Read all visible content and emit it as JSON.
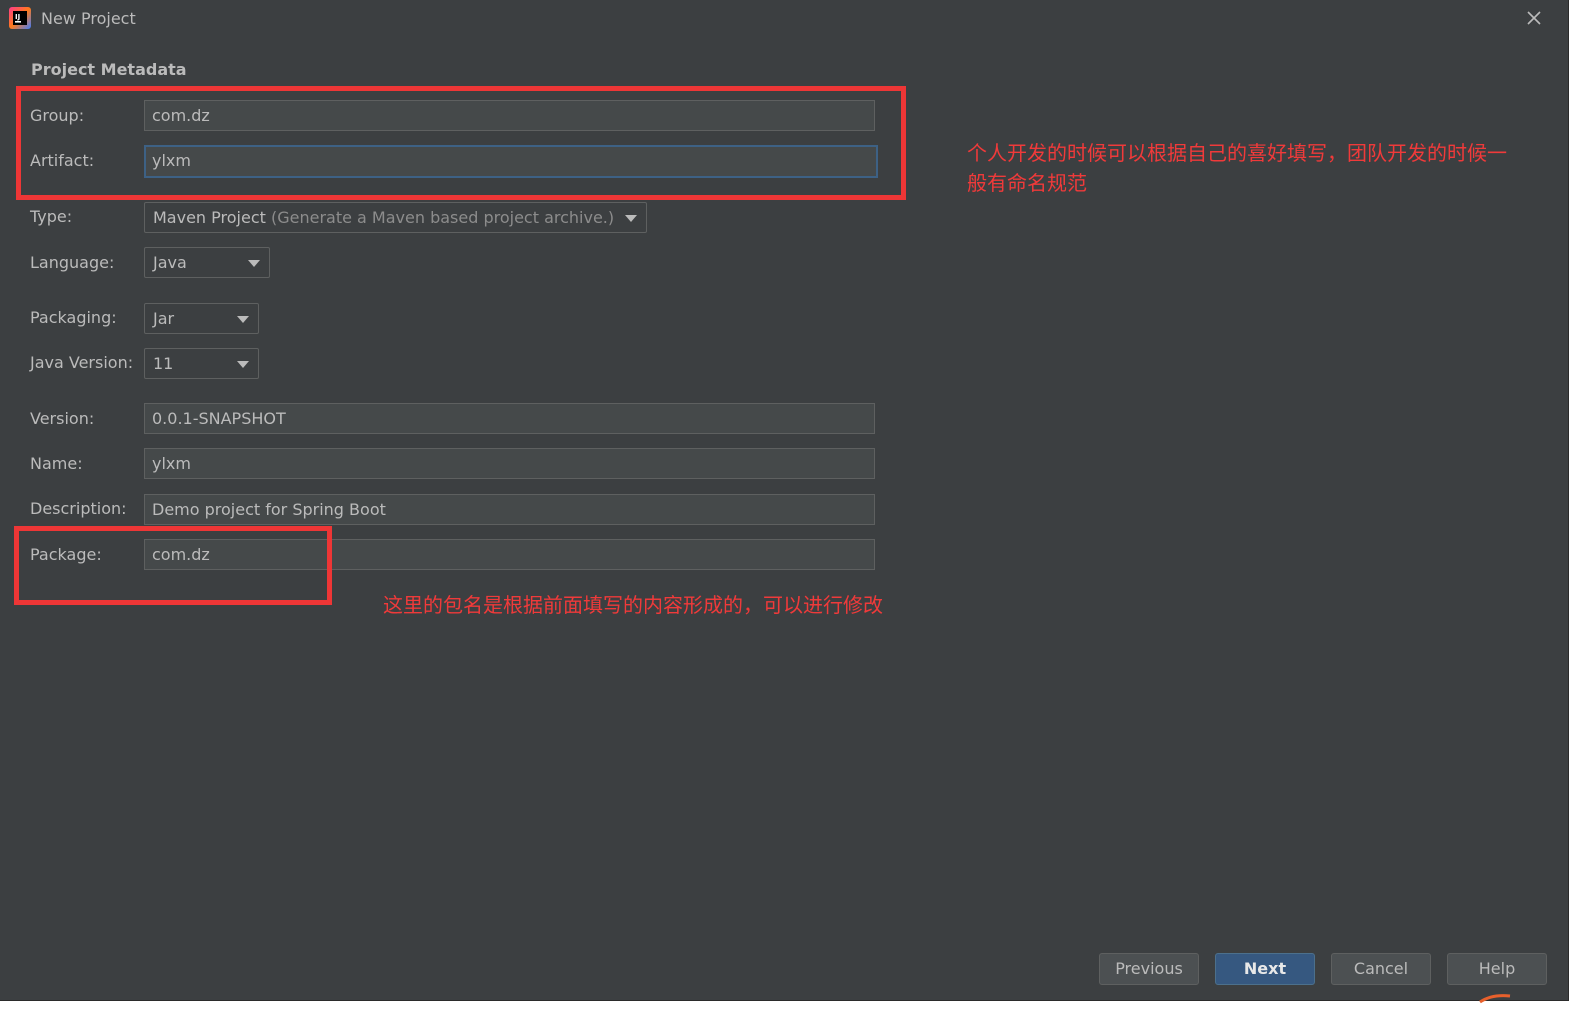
{
  "window": {
    "title": "New Project"
  },
  "section": {
    "title": "Project Metadata"
  },
  "form": {
    "group": {
      "label": "Group:",
      "value": "com.dz"
    },
    "artifact": {
      "label": "Artifact:",
      "value": "ylxm"
    },
    "type": {
      "label": "Type:",
      "value": "Maven Project",
      "hint": "(Generate a Maven based project archive.)"
    },
    "language": {
      "label": "Language:",
      "value": "Java"
    },
    "packaging": {
      "label": "Packaging:",
      "value": "Jar"
    },
    "java_version": {
      "label": "Java Version:",
      "value": "11"
    },
    "version": {
      "label": "Version:",
      "value": "0.0.1-SNAPSHOT"
    },
    "name": {
      "label": "Name:",
      "value": "ylxm"
    },
    "description": {
      "label": "Description:",
      "value": "Demo project for Spring Boot"
    },
    "package": {
      "label": "Package:",
      "value": "com.dz"
    }
  },
  "annotations": {
    "group_note_line1": "个人开发的时候可以根据自己的喜好填写，团队开发的时候一",
    "group_note_line2": "般有命名规范",
    "package_note": "这里的包名是根据前面填写的内容形成的，可以进行修改"
  },
  "buttons": {
    "previous": "Previous",
    "next": "Next",
    "cancel": "Cancel",
    "help": "Help"
  },
  "colors": {
    "background": "#3c3f41",
    "field_bg": "#45494a",
    "focus_border": "#3d6185",
    "primary_button": "#365880",
    "annotation_red": "#ee3636"
  }
}
